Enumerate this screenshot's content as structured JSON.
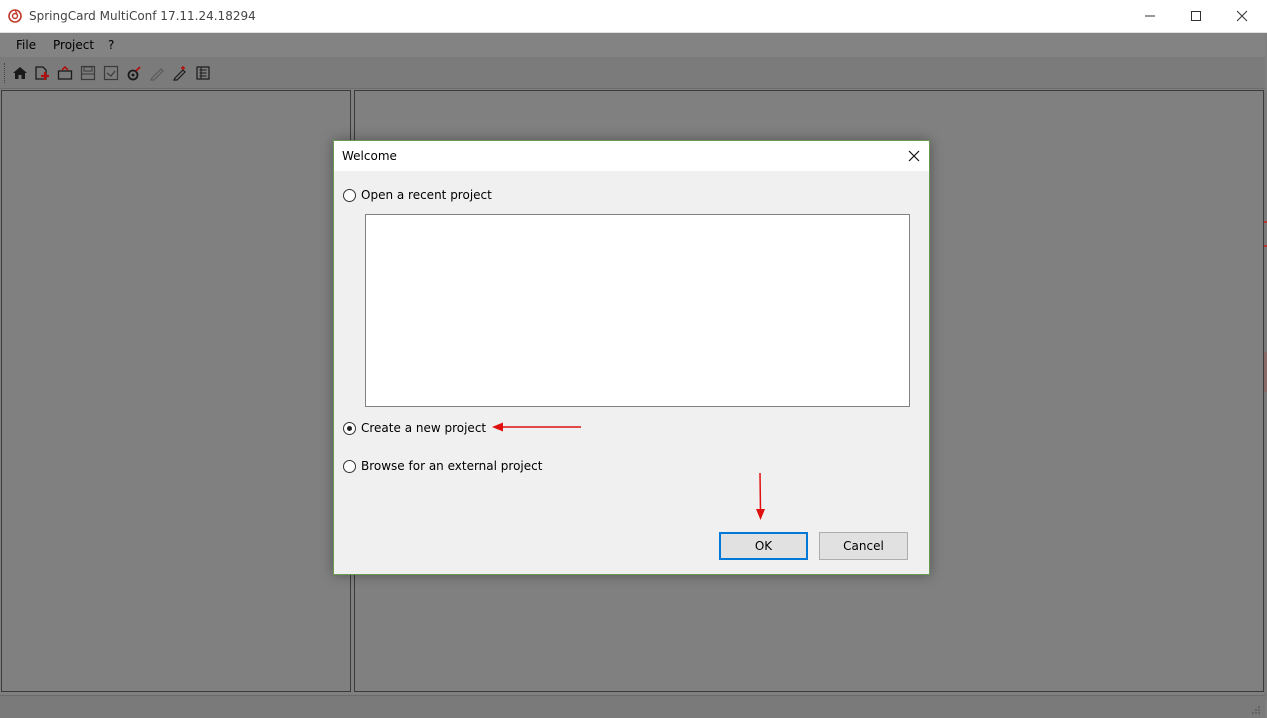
{
  "window": {
    "title": "SpringCard MultiConf 17.11.24.18294",
    "controls": [
      "minimize-icon",
      "maximize-icon",
      "close-icon"
    ]
  },
  "menu": {
    "items": [
      {
        "label": "File"
      },
      {
        "label": "Project"
      },
      {
        "label": "?"
      }
    ]
  },
  "toolbar": {
    "icons": [
      "home-icon",
      "new-project-icon",
      "open-project-icon",
      "save-icon",
      "save-as-icon",
      "settings-icon",
      "edit-icon",
      "write-config-icon",
      "report-icon"
    ]
  },
  "dialog": {
    "title": "Welcome",
    "options": {
      "recent": "Open a recent project",
      "new": "Create a new project",
      "browse": "Browse for an external project"
    },
    "selected": "new",
    "ok_label": "OK",
    "cancel_label": "Cancel"
  },
  "colors": {
    "annotation_arrow": "#e01010",
    "default_button_border": "#0078d7",
    "dialog_border": "#6a9a4f"
  }
}
